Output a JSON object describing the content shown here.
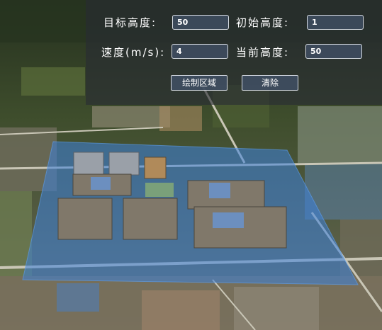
{
  "controls": {
    "target_height": {
      "label": "目标高度:",
      "value": "50"
    },
    "initial_height": {
      "label": "初始高度:",
      "value": "1"
    },
    "speed": {
      "label": "速度(m/s):",
      "value": "4"
    },
    "current_height": {
      "label": "当前高度:",
      "value": "50"
    }
  },
  "buttons": {
    "draw_area": "绘制区域",
    "clear": "清除"
  },
  "colors": {
    "panel_bg": "#282c34",
    "input_bg": "#3f4e62",
    "highlight_area": "#3d82dc"
  }
}
